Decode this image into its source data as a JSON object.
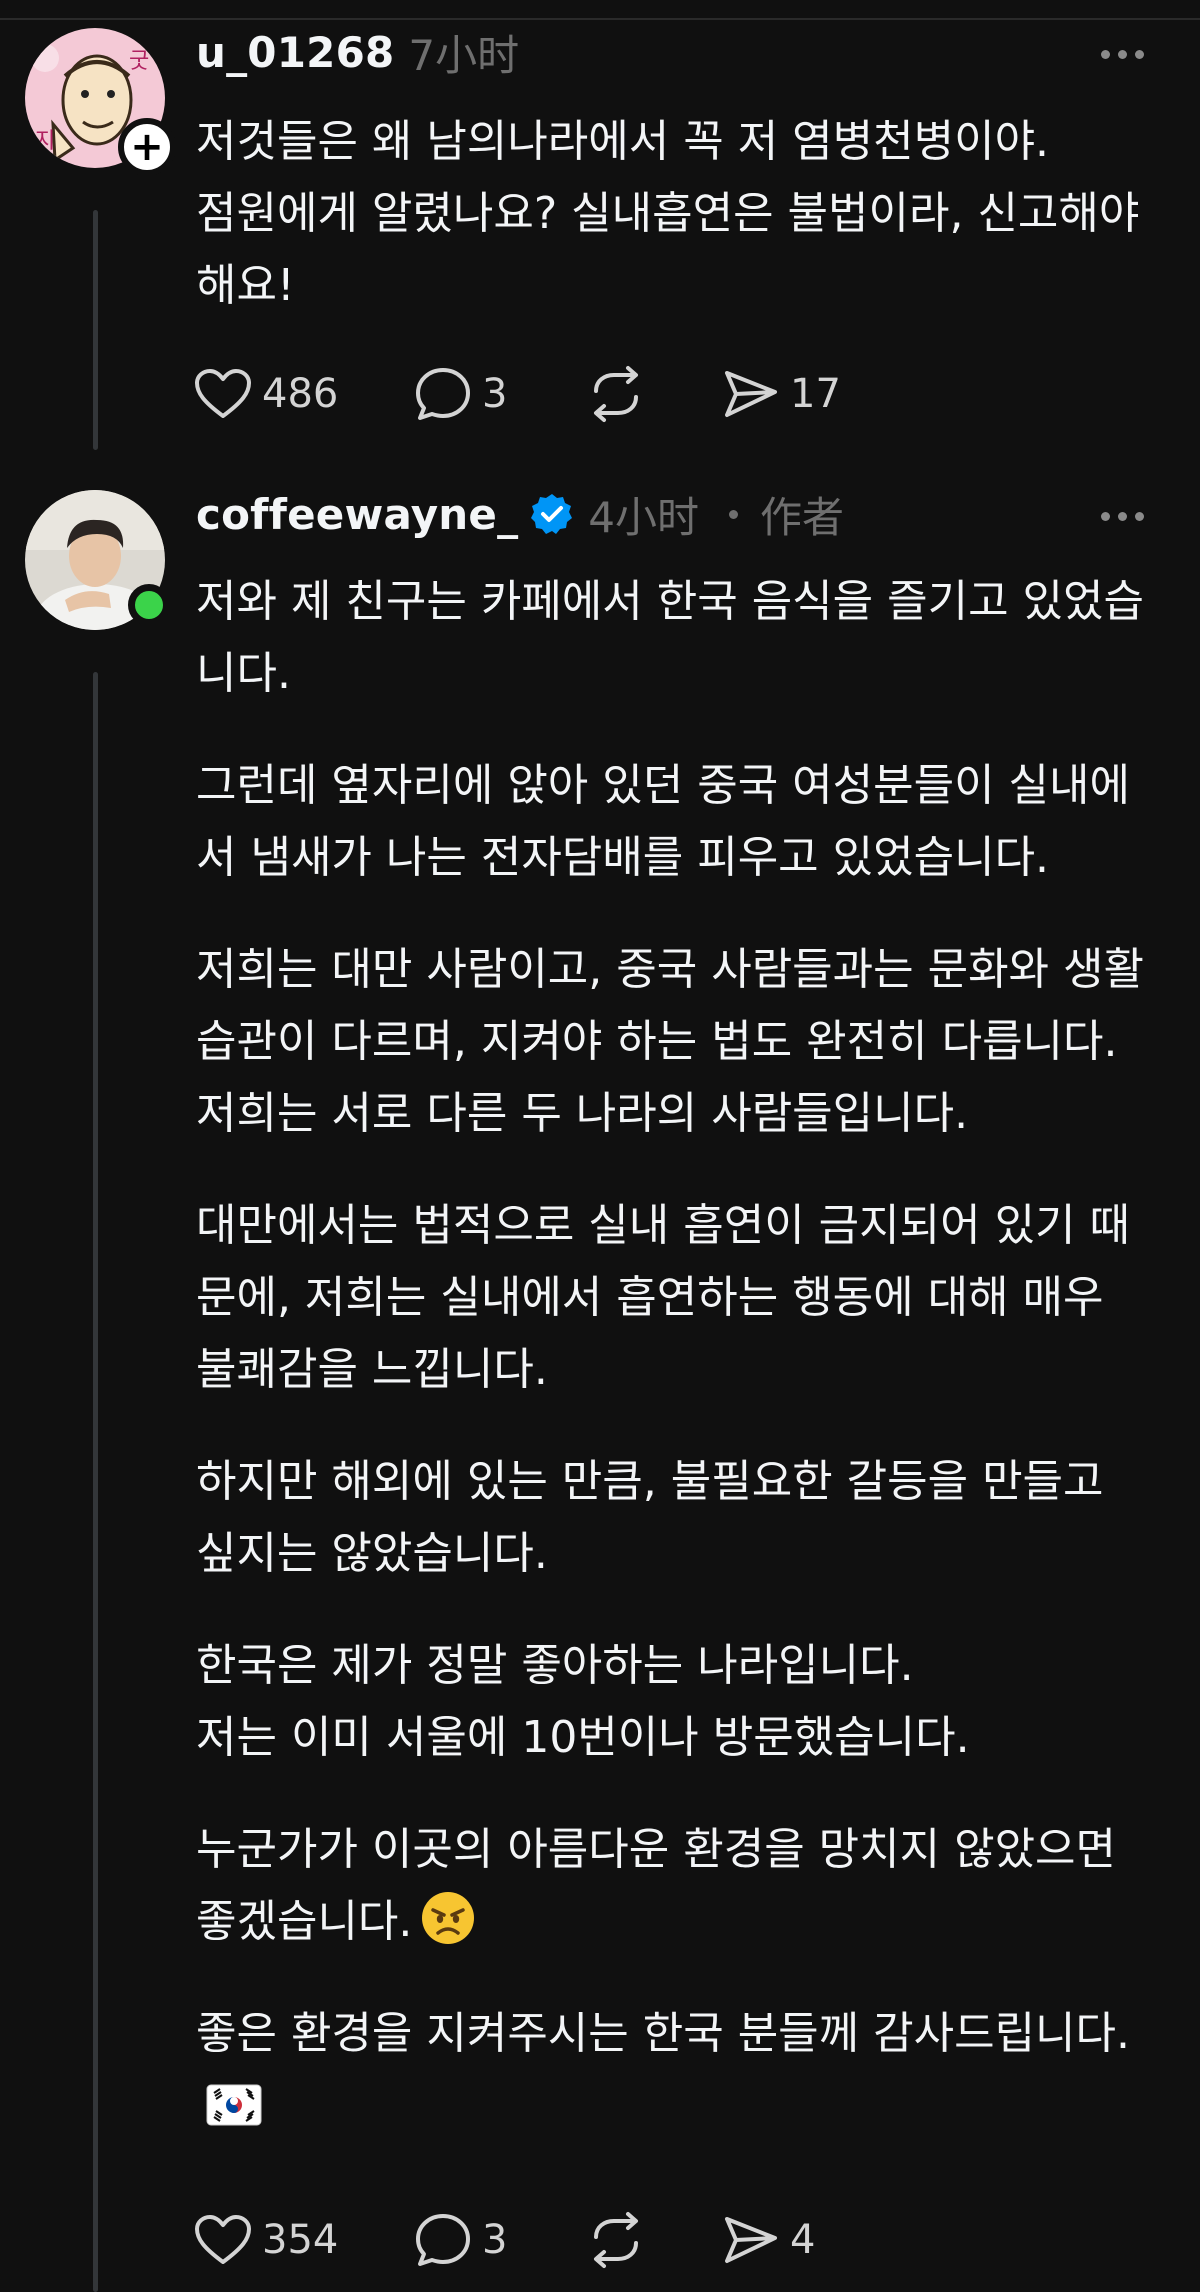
{
  "posts": [
    {
      "username": "u_01268",
      "time": "7小时",
      "paragraphs": [
        "저것들은 왜 남의나라에서 꼭 저 염병천병이야.\n점원에게 알렸나요? 실내흡연은 불법이라, 신고해야해요!"
      ],
      "likes": "486",
      "replies": "3",
      "shares": "17",
      "avatar_text": "지 굿"
    },
    {
      "username": "coffeewayne_",
      "time": "4小时",
      "author_tag": "作者",
      "paragraphs": [
        "저와 제 친구는 카페에서 한국 음식을 즐기고 있었습니다.",
        "그런데 옆자리에 앉아 있던 중국 여성분들이 실내에서 냄새가 나는 전자담배를 피우고 있었습니다.",
        "저희는 대만 사람이고, 중국 사람들과는 문화와 생활 습관이 다르며, 지켜야 하는 법도 완전히 다릅니다. 저희는 서로 다른 두 나라의 사람들입니다.",
        "대만에서는 법적으로 실내 흡연이 금지되어 있기 때문에, 저희는 실내에서 흡연하는 행동에 대해 매우 불쾌감을 느낍니다.",
        "하지만 해외에 있는 만큼, 불필요한 갈등을 만들고 싶지는 않았습니다.",
        "한국은 제가 정말 좋아하는 나라입니다.\n저는 이미 서울에 10번이나 방문했습니다.",
        "누군가가 이곳의 아름다운 환경을 망치지 않았으면 좋겠습니다.",
        "좋은 환경을 지켜주시는 한국 분들께 감사드립니다."
      ],
      "likes": "354",
      "replies": "3",
      "shares": "4"
    }
  ],
  "icons": {
    "like": "heart-icon",
    "reply": "comment-bubble-icon",
    "repost": "repost-icon",
    "share": "send-icon",
    "more": "more-dots-icon",
    "verified": "verified-badge-icon",
    "angry": "angry-face-emoji",
    "flag": "south-korea-flag-emoji"
  },
  "colors": {
    "background": "#101010",
    "text": "#f3f5f7",
    "muted": "#6f6f6f",
    "verified": "#0095f6",
    "online": "#3bd34a"
  }
}
